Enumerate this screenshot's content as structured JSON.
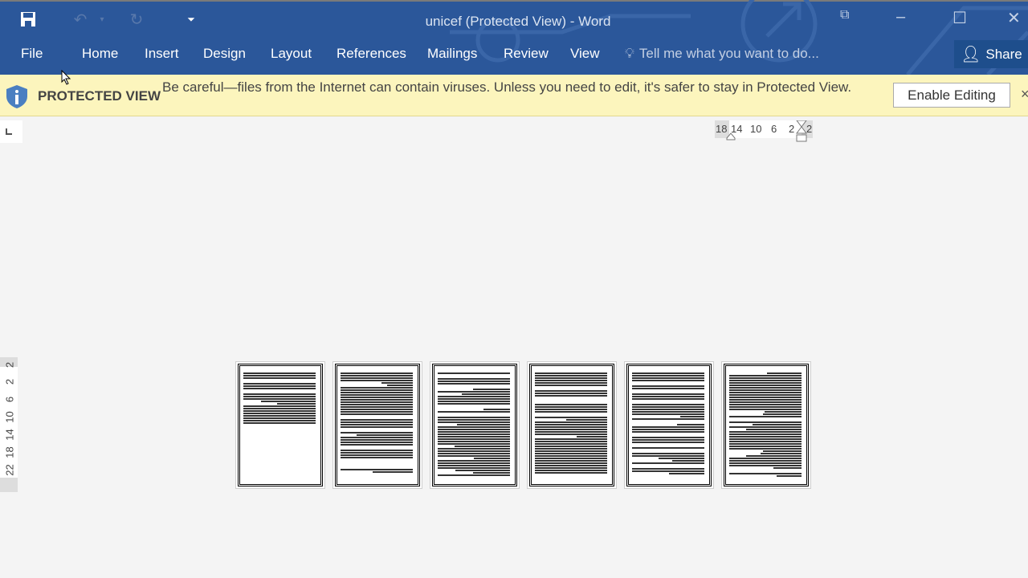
{
  "window": {
    "title": "unicef (Protected View) - Word"
  },
  "quick_access": {
    "save_icon": "save-icon",
    "undo_icon": "undo-icon",
    "redo_icon": "redo-icon",
    "customize_icon": "customize-dropdown-icon"
  },
  "ribbon": {
    "tabs": [
      "File",
      "Home",
      "Insert",
      "Design",
      "Layout",
      "References",
      "Mailings",
      "Review",
      "View"
    ],
    "tell_me": "Tell me what you want to do...",
    "share": "Share"
  },
  "protected_view": {
    "title": "PROTECTED VIEW",
    "message": "Be careful—files from the Internet can contain viruses. Unless you need to edit, it's safer to stay in Protected View.",
    "enable_button": "Enable Editing",
    "close": "×"
  },
  "ruler": {
    "horizontal": [
      "18",
      "14",
      "10",
      "6",
      "2",
      "2"
    ],
    "vertical": [
      "2",
      "2",
      "6",
      "10",
      "14",
      "18",
      "22"
    ]
  },
  "pages": {
    "count": 6
  },
  "colors": {
    "accent": "#2b579a",
    "banner": "#fcf5bd"
  }
}
